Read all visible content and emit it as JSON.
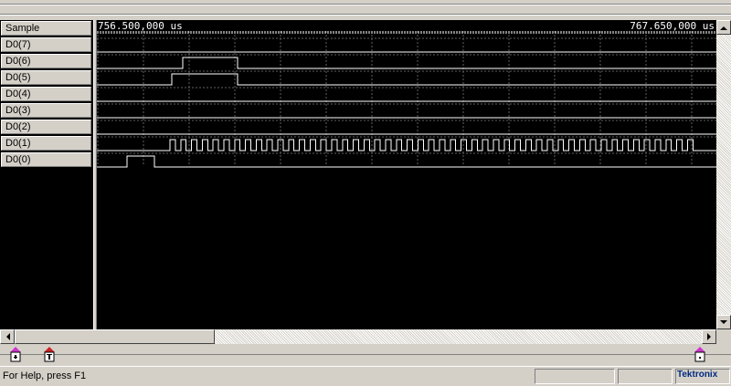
{
  "signals": [
    {
      "label": "Sample",
      "wave": null
    },
    {
      "label": "D0(7)",
      "wave": "low"
    },
    {
      "label": "D0(6)",
      "wave": "pulse_d06"
    },
    {
      "label": "D0(5)",
      "wave": "pulse_d05"
    },
    {
      "label": "D0(4)",
      "wave": "low"
    },
    {
      "label": "D0(3)",
      "wave": "low"
    },
    {
      "label": "D0(2)",
      "wave": "low"
    },
    {
      "label": "D0(1)",
      "wave": "clock"
    },
    {
      "label": "D0(0)",
      "wave": "pulse_d00"
    }
  ],
  "timeline": {
    "start": "756.500,000 us",
    "end": "767.650,000 us"
  },
  "status": {
    "help_text": "For Help, press F1",
    "brand": "Tektronix"
  },
  "colors": {
    "background": "#000000",
    "trace": "#ffffff",
    "grid": "#606060",
    "marker_magenta": "#cc33cc",
    "marker_red": "#cc2222"
  }
}
